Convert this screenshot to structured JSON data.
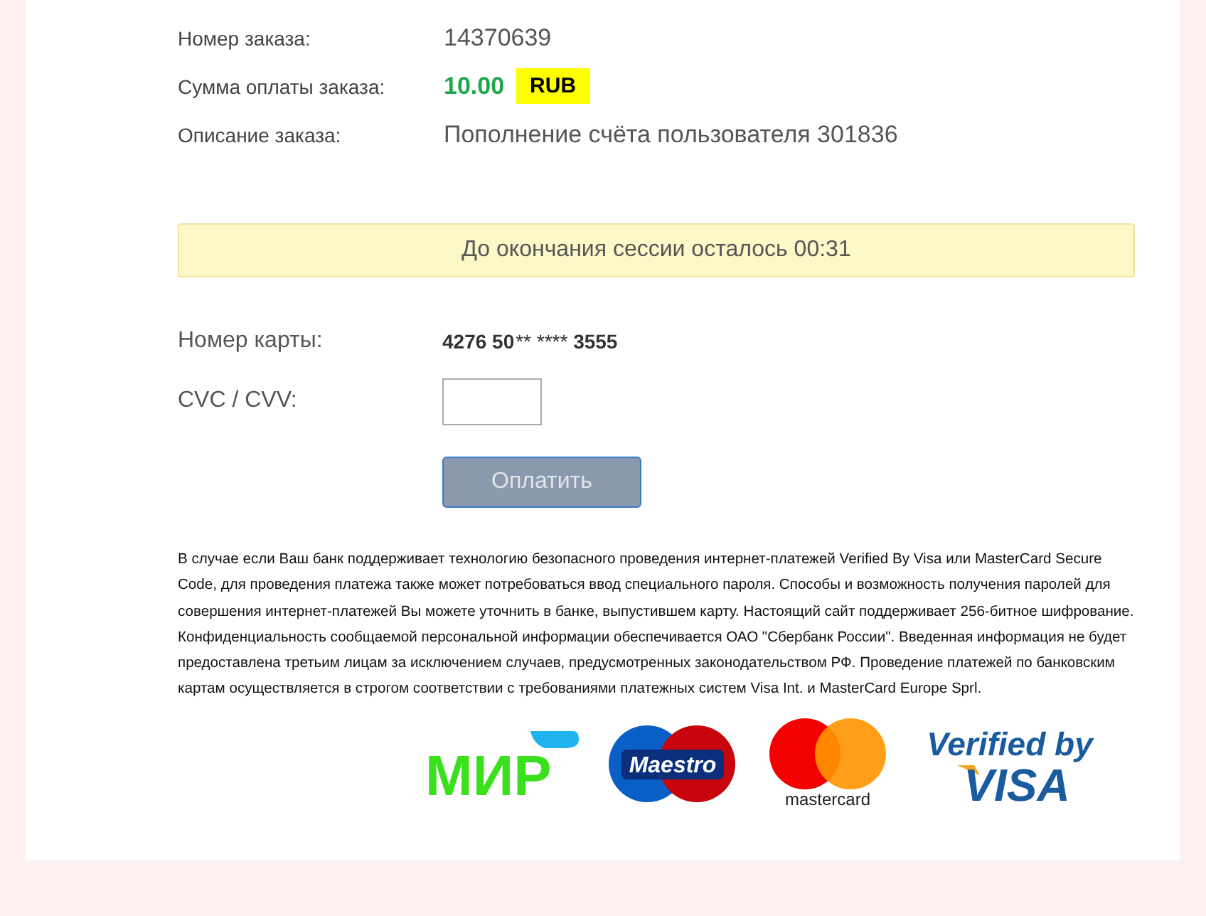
{
  "order": [
    {
      "kind": "number",
      "label": "Номер заказа:",
      "value": "14370639"
    },
    {
      "kind": "amount",
      "label": "Сумма оплаты заказа:",
      "value": "10.00",
      "currency": "RUB"
    },
    {
      "kind": "text",
      "label": "Описание заказа:",
      "value": "Пополнение счёта пользователя 301836"
    }
  ],
  "session_notice": "До окончания сессии осталось 00:31",
  "card": {
    "label": "Номер карты:",
    "start": "4276 50",
    "masked": "** ****",
    "end": "3555"
  },
  "cvc": {
    "label": "CVC / CVV:"
  },
  "pay_button": {
    "label": "Оплатить",
    "disabled": true
  },
  "disclaimer": "В случае если Ваш банк поддерживает технологию безопасного проведения интернет-платежей Verified By Visa или MasterCard Secure Code, для проведения платежа также может потребоваться ввод специального пароля. Способы и возможность получения паролей для совершения интернет-платежей Вы можете уточнить в банке, выпустившем карту. Настоящий сайт поддерживает 256-битное шифрование. Конфиденциальность сообщаемой персональной информации обеспечивается ОАО \"Сбербанк России\". Введенная информация не будет предоставлена третьим лицам за исключением случаев, предусмотренных законодательством РФ. Проведение платежей по банковским картам осуществляется в строгом соответствии с требованиями платежных систем Visa Int. и MasterCard Europe Sprl.",
  "logos": [
    {
      "kind": "mir",
      "text": "МИР"
    },
    {
      "kind": "maestro",
      "text": "Maestro"
    },
    {
      "kind": "mastercard",
      "text": "mastercard"
    },
    {
      "kind": "visa",
      "text": "Verified by",
      "text2": "VISA"
    }
  ]
}
